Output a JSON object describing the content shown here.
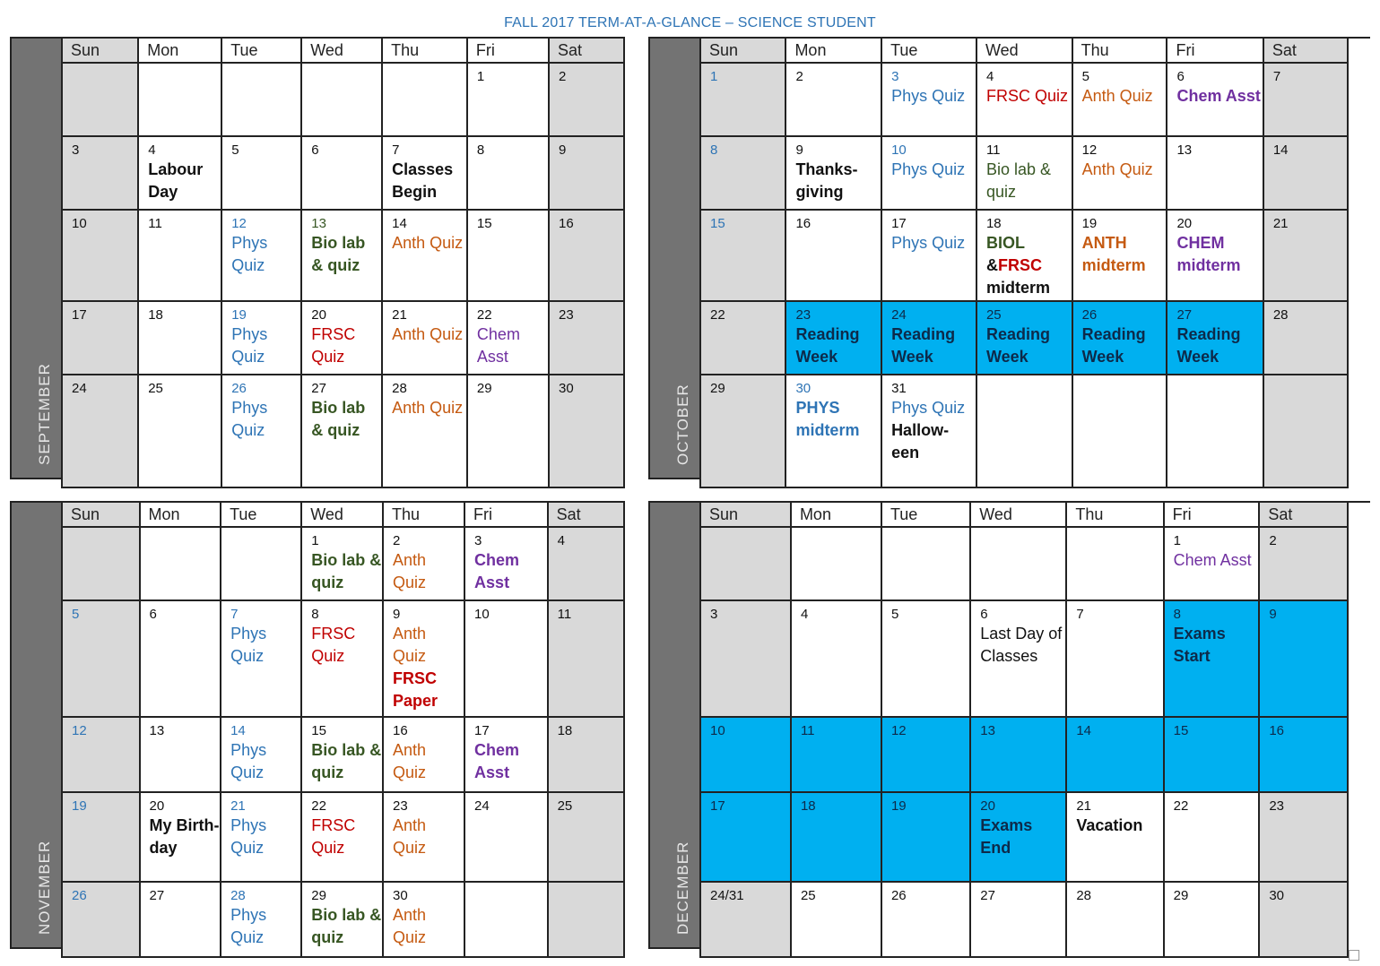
{
  "title": "FALL 2017 TERM-AT-A-GLANCE – SCIENCE STUDENT",
  "weekdays": [
    "Sun",
    "Mon",
    "Tue",
    "Wed",
    "Thu",
    "Fri",
    "Sat"
  ],
  "colors": {
    "title": "#2e74b5",
    "phys": "#2e74b5",
    "frsc": "#c00000",
    "anth": "#c55a11",
    "chem": "#7030a0",
    "bio": "#375623",
    "highlight": "#00b0f0",
    "weekend": "#d9d9d9",
    "month_bar": "#737373"
  },
  "months": [
    {
      "name": "SEPTEMBER",
      "weeks": [
        [
          {
            "d": ""
          },
          {
            "d": ""
          },
          {
            "d": ""
          },
          {
            "d": ""
          },
          {
            "d": ""
          },
          {
            "d": "1"
          },
          {
            "d": "2"
          }
        ],
        [
          {
            "d": "3"
          },
          {
            "d": "4",
            "ev": [
              {
                "t": "Labour Day",
                "c": "black",
                "b": true
              }
            ]
          },
          {
            "d": "5"
          },
          {
            "d": "6"
          },
          {
            "d": "7",
            "ev": [
              {
                "t": "Classes Begin",
                "c": "black",
                "b": true
              }
            ]
          },
          {
            "d": "8"
          },
          {
            "d": "9"
          }
        ],
        [
          {
            "d": "10"
          },
          {
            "d": "11"
          },
          {
            "d": "12",
            "dc": "phys",
            "ev": [
              {
                "t": "Phys Quiz",
                "c": "phys"
              }
            ]
          },
          {
            "d": "13",
            "dc": "bio",
            "ev": [
              {
                "t": "Bio lab & quiz",
                "c": "bio",
                "b": true
              }
            ]
          },
          {
            "d": "14",
            "ev": [
              {
                "t": "Anth Quiz",
                "c": "anth"
              }
            ]
          },
          {
            "d": "15"
          },
          {
            "d": "16"
          }
        ],
        [
          {
            "d": "17"
          },
          {
            "d": "18"
          },
          {
            "d": "19",
            "dc": "phys",
            "ev": [
              {
                "t": "Phys Quiz",
                "c": "phys"
              }
            ]
          },
          {
            "d": "20",
            "ev": [
              {
                "t": "FRSC Quiz",
                "c": "frsc"
              }
            ]
          },
          {
            "d": "21",
            "ev": [
              {
                "t": "Anth Quiz",
                "c": "anth"
              }
            ]
          },
          {
            "d": "22",
            "ev": [
              {
                "t": "Chem Asst",
                "c": "chem"
              }
            ]
          },
          {
            "d": "23"
          }
        ],
        [
          {
            "d": "24"
          },
          {
            "d": "25"
          },
          {
            "d": "26",
            "dc": "phys",
            "ev": [
              {
                "t": "Phys Quiz",
                "c": "phys"
              }
            ]
          },
          {
            "d": "27",
            "ev": [
              {
                "t": "Bio lab & quiz",
                "c": "bio",
                "b": true
              }
            ]
          },
          {
            "d": "28",
            "ev": [
              {
                "t": "Anth Quiz",
                "c": "anth"
              }
            ]
          },
          {
            "d": "29"
          },
          {
            "d": "30"
          }
        ]
      ]
    },
    {
      "name": "OCTOBER",
      "weeks": [
        [
          {
            "d": "1",
            "dc": "phys"
          },
          {
            "d": "2"
          },
          {
            "d": "3",
            "dc": "phys",
            "ev": [
              {
                "t": "Phys Quiz",
                "c": "phys"
              }
            ]
          },
          {
            "d": "4",
            "ev": [
              {
                "t": "FRSC Quiz",
                "c": "frsc"
              }
            ]
          },
          {
            "d": "5",
            "ev": [
              {
                "t": "Anth Quiz",
                "c": "anth"
              }
            ]
          },
          {
            "d": "6",
            "ev": [
              {
                "t": "Chem Asst",
                "c": "chem",
                "b": true
              }
            ]
          },
          {
            "d": "7"
          }
        ],
        [
          {
            "d": "8",
            "dc": "phys"
          },
          {
            "d": "9",
            "ev": [
              {
                "t": "Thanks-giving",
                "c": "black",
                "b": true
              }
            ]
          },
          {
            "d": "10",
            "dc": "phys",
            "ev": [
              {
                "t": "Phys Quiz",
                "c": "phys"
              }
            ]
          },
          {
            "d": "11",
            "ev": [
              {
                "t": "Bio lab & quiz",
                "c": "bio"
              }
            ]
          },
          {
            "d": "12",
            "ev": [
              {
                "t": "Anth Quiz",
                "c": "anth"
              }
            ]
          },
          {
            "d": "13"
          },
          {
            "d": "14"
          }
        ],
        [
          {
            "d": "15",
            "dc": "phys"
          },
          {
            "d": "16"
          },
          {
            "d": "17",
            "ev": [
              {
                "t": "Phys Quiz",
                "c": "phys"
              }
            ]
          },
          {
            "d": "18",
            "ev": [
              {
                "t": "BIOL",
                "c": "bio",
                "b": true
              },
              {
                "t": "&",
                "c": "black",
                "b": true,
                "inline": "FRSC",
                "ic": "frsc"
              },
              {
                "t": "midterm",
                "c": "black",
                "b": true
              }
            ]
          },
          {
            "d": "19",
            "ev": [
              {
                "t": "ANTH midterm",
                "c": "anth",
                "b": true
              }
            ]
          },
          {
            "d": "20",
            "ev": [
              {
                "t": "CHEM midterm",
                "c": "chem",
                "b": true
              }
            ]
          },
          {
            "d": "21"
          }
        ],
        [
          {
            "d": "22"
          },
          {
            "d": "23",
            "hl": true,
            "ev": [
              {
                "t": "Reading Week",
                "c": "dark",
                "b": true
              }
            ]
          },
          {
            "d": "24",
            "hl": true,
            "ev": [
              {
                "t": "Reading Week",
                "c": "dark",
                "b": true
              }
            ]
          },
          {
            "d": "25",
            "hl": true,
            "ev": [
              {
                "t": "Reading Week",
                "c": "dark",
                "b": true
              }
            ]
          },
          {
            "d": "26",
            "hl": true,
            "ev": [
              {
                "t": "Reading Week",
                "c": "dark",
                "b": true
              }
            ]
          },
          {
            "d": "27",
            "hl": true,
            "ev": [
              {
                "t": "Reading Week",
                "c": "dark",
                "b": true
              }
            ]
          },
          {
            "d": "28"
          }
        ],
        [
          {
            "d": "29"
          },
          {
            "d": "30",
            "dc": "phys",
            "ev": [
              {
                "t": "PHYS midterm",
                "c": "phys",
                "b": true
              }
            ]
          },
          {
            "d": "31",
            "ev": [
              {
                "t": "Phys Quiz",
                "c": "phys"
              },
              {
                "t": "Hallow-een",
                "c": "black",
                "b": true
              }
            ]
          },
          {
            "d": ""
          },
          {
            "d": ""
          },
          {
            "d": ""
          },
          {
            "d": ""
          }
        ]
      ]
    },
    {
      "name": "NOVEMBER",
      "weeks": [
        [
          {
            "d": ""
          },
          {
            "d": ""
          },
          {
            "d": ""
          },
          {
            "d": "1",
            "ev": [
              {
                "t": "Bio lab & quiz",
                "c": "bio",
                "b": true
              }
            ]
          },
          {
            "d": "2",
            "ev": [
              {
                "t": "Anth Quiz",
                "c": "anth"
              }
            ]
          },
          {
            "d": "3",
            "ev": [
              {
                "t": "Chem Asst",
                "c": "chem",
                "b": true
              }
            ]
          },
          {
            "d": "4"
          }
        ],
        [
          {
            "d": "5",
            "dc": "phys"
          },
          {
            "d": "6"
          },
          {
            "d": "7",
            "dc": "phys",
            "ev": [
              {
                "t": "Phys Quiz",
                "c": "phys"
              }
            ]
          },
          {
            "d": "8",
            "ev": [
              {
                "t": "FRSC Quiz",
                "c": "frsc"
              }
            ]
          },
          {
            "d": "9",
            "ev": [
              {
                "t": "Anth Quiz",
                "c": "anth"
              },
              {
                "t": "FRSC Paper",
                "c": "frsc",
                "b": true
              }
            ]
          },
          {
            "d": "10"
          },
          {
            "d": "11"
          }
        ],
        [
          {
            "d": "12",
            "dc": "phys"
          },
          {
            "d": "13"
          },
          {
            "d": "14",
            "dc": "phys",
            "ev": [
              {
                "t": "Phys Quiz",
                "c": "phys"
              }
            ]
          },
          {
            "d": "15",
            "ev": [
              {
                "t": "Bio lab & quiz",
                "c": "bio",
                "b": true
              }
            ]
          },
          {
            "d": "16",
            "ev": [
              {
                "t": "Anth Quiz",
                "c": "anth"
              }
            ]
          },
          {
            "d": "17",
            "ev": [
              {
                "t": "Chem Asst",
                "c": "chem",
                "b": true
              }
            ]
          },
          {
            "d": "18"
          }
        ],
        [
          {
            "d": "19",
            "dc": "phys"
          },
          {
            "d": "20",
            "ev": [
              {
                "t": "My Birth-day",
                "c": "black",
                "b": true
              }
            ]
          },
          {
            "d": "21",
            "dc": "phys",
            "ev": [
              {
                "t": "Phys Quiz",
                "c": "phys"
              }
            ]
          },
          {
            "d": "22",
            "ev": [
              {
                "t": "FRSC Quiz",
                "c": "frsc"
              }
            ]
          },
          {
            "d": "23",
            "ev": [
              {
                "t": "Anth Quiz",
                "c": "anth"
              }
            ]
          },
          {
            "d": "24"
          },
          {
            "d": "25"
          }
        ],
        [
          {
            "d": "26",
            "dc": "phys"
          },
          {
            "d": "27"
          },
          {
            "d": "28",
            "dc": "phys",
            "ev": [
              {
                "t": "Phys Quiz",
                "c": "phys"
              }
            ]
          },
          {
            "d": "29",
            "ev": [
              {
                "t": "Bio lab & quiz",
                "c": "bio",
                "b": true
              }
            ]
          },
          {
            "d": "30",
            "ev": [
              {
                "t": "Anth Quiz",
                "c": "anth"
              }
            ]
          },
          {
            "d": ""
          },
          {
            "d": ""
          }
        ]
      ]
    },
    {
      "name": "DECEMBER",
      "weeks": [
        [
          {
            "d": ""
          },
          {
            "d": ""
          },
          {
            "d": ""
          },
          {
            "d": ""
          },
          {
            "d": ""
          },
          {
            "d": "1",
            "ev": [
              {
                "t": "Chem Asst",
                "c": "chem"
              }
            ]
          },
          {
            "d": "2"
          }
        ],
        [
          {
            "d": "3"
          },
          {
            "d": "4"
          },
          {
            "d": "5"
          },
          {
            "d": "6",
            "ev": [
              {
                "t": "Last Day of Classes",
                "c": "black"
              }
            ]
          },
          {
            "d": "7"
          },
          {
            "d": "8",
            "hl": true,
            "ev": [
              {
                "t": "Exams Start",
                "c": "dark",
                "b": true
              }
            ]
          },
          {
            "d": "9",
            "hl": true
          }
        ],
        [
          {
            "d": "10",
            "hl": true
          },
          {
            "d": "11",
            "hl": true
          },
          {
            "d": "12",
            "hl": true
          },
          {
            "d": "13",
            "hl": true
          },
          {
            "d": "14",
            "hl": true
          },
          {
            "d": "15",
            "hl": true
          },
          {
            "d": "16",
            "hl": true
          }
        ],
        [
          {
            "d": "17",
            "hl": true
          },
          {
            "d": "18",
            "hl": true
          },
          {
            "d": "19",
            "hl": true
          },
          {
            "d": "20",
            "hl": true,
            "ev": [
              {
                "t": "Exams End",
                "c": "dark",
                "b": true
              }
            ]
          },
          {
            "d": "21",
            "ev": [
              {
                "t": "Vacation",
                "c": "black",
                "b": true
              }
            ]
          },
          {
            "d": "22"
          },
          {
            "d": "23"
          }
        ],
        [
          {
            "d": "24/31"
          },
          {
            "d": "25"
          },
          {
            "d": "26"
          },
          {
            "d": "27"
          },
          {
            "d": "28"
          },
          {
            "d": "29"
          },
          {
            "d": "30"
          }
        ]
      ]
    }
  ]
}
